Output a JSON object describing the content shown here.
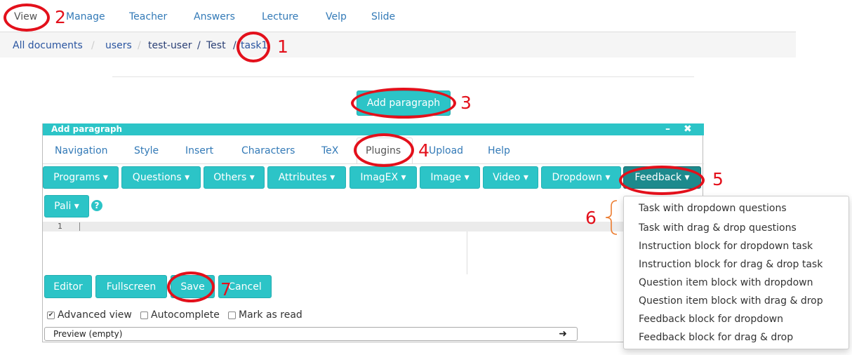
{
  "top_tabs": [
    {
      "label": "View",
      "active": true
    },
    {
      "label": "Manage"
    },
    {
      "label": "Teacher"
    },
    {
      "label": "Answers"
    },
    {
      "label": "Lecture"
    },
    {
      "label": "Velp"
    },
    {
      "label": "Slide"
    }
  ],
  "breadcrumb": {
    "items": [
      "All documents",
      "users",
      "test-user",
      "Test",
      "task1"
    ],
    "separator": "/"
  },
  "add_paragraph_label": "Add paragraph",
  "dialog": {
    "title": "Add paragraph",
    "minimize": "–",
    "close": "✖",
    "tabs": [
      "Navigation",
      "Style",
      "Insert",
      "Characters",
      "TeX",
      "Plugins",
      "Upload",
      "Help"
    ],
    "active_tab": "Plugins",
    "dropdowns": [
      "Programs",
      "Questions",
      "Others",
      "Attributes",
      "ImagEX",
      "Image",
      "Video",
      "Dropdown",
      "Feedback"
    ],
    "caret": "▾",
    "second_row_dropdown": "Pali",
    "help_icon": "?",
    "editor": {
      "line_number": "1",
      "content": ""
    },
    "buttons": [
      "Editor",
      "Fullscreen",
      "Save",
      "Cancel"
    ],
    "checkboxes": [
      {
        "label": "Advanced view",
        "checked": true
      },
      {
        "label": "Autocomplete",
        "checked": false
      },
      {
        "label": "Mark as read",
        "checked": false
      }
    ],
    "preview_label": "Preview (empty)",
    "preview_arrow": "➜"
  },
  "feedback_menu": [
    "Task with dropdown questions",
    "Task with drag & drop questions",
    "Instruction block for dropdown task",
    "Instruction block for drag & drop task",
    "Question item block with dropdown",
    "Question item block with drag & drop",
    "Feedback block for dropdown",
    "Feedback block for drag & drop"
  ],
  "annotation_numbers": [
    "1",
    "2",
    "3",
    "4",
    "5",
    "6",
    "7"
  ],
  "colors": {
    "teal": "#2cc4c7",
    "teal_dark": "#1d8a8d",
    "annotation_red": "#e3101b",
    "link_blue": "#337ab7"
  }
}
